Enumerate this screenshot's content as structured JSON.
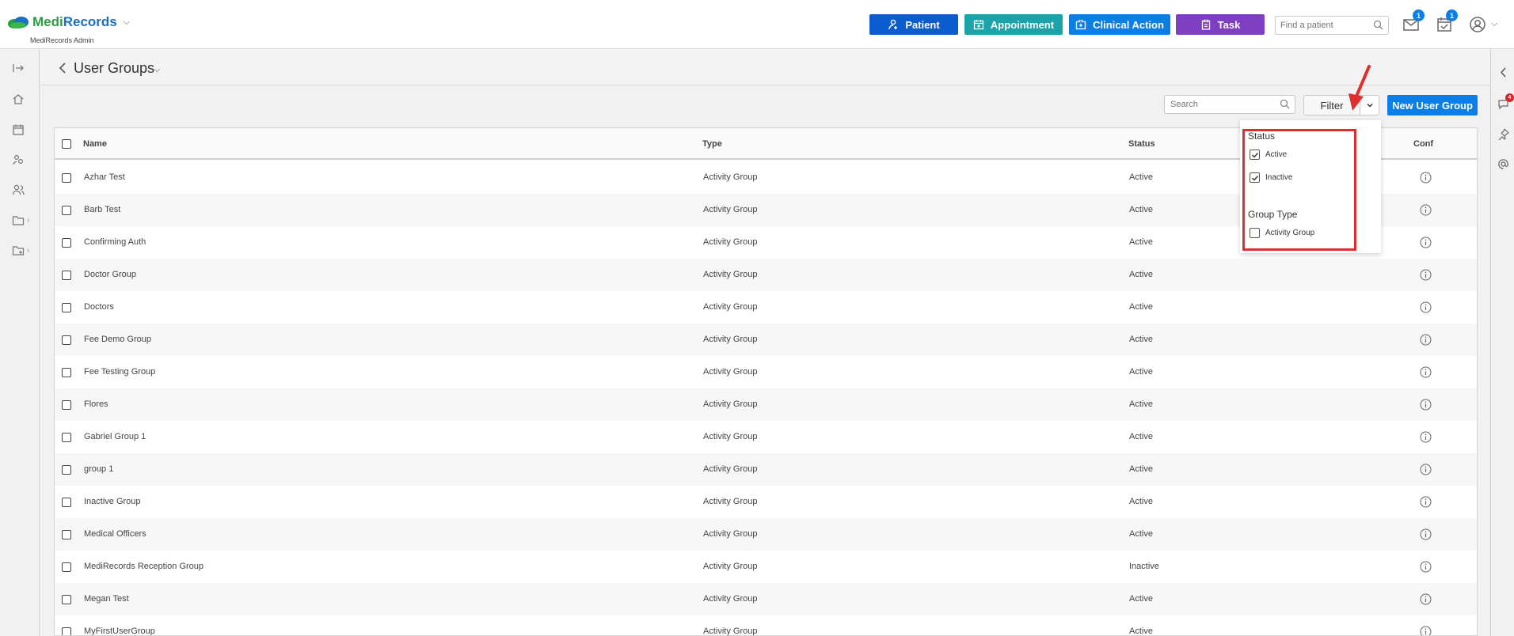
{
  "brand": {
    "name_part1": "Medi",
    "name_part2": "Records",
    "subtitle": "MediRecords Admin"
  },
  "topbar": {
    "patient_label": "Patient",
    "appointment_label": "Appointment",
    "clinical_action_label": "Clinical Action",
    "task_label": "Task",
    "find_patient_placeholder": "Find a patient",
    "messages_count": "1",
    "tasks_count": "1"
  },
  "colors": {
    "patient": "#0a5ccf",
    "appointment": "#1aa3a8",
    "clinical_action": "#0c7ee8",
    "task": "#7e3fc2",
    "primary": "#0c7ee8",
    "highlight": "#e02d2d"
  },
  "right_rail": {
    "notification_count": "4"
  },
  "page": {
    "title": "User Groups"
  },
  "toolbar": {
    "search_placeholder": "Search",
    "filter_label": "Filter",
    "new_label": "New User Group"
  },
  "filter": {
    "status_heading": "Status",
    "status_options": [
      {
        "label": "Active",
        "checked": true
      },
      {
        "label": "Inactive",
        "checked": true
      }
    ],
    "group_type_heading": "Group Type",
    "group_type_options": [
      {
        "label": "Activity Group",
        "checked": false
      }
    ]
  },
  "table": {
    "columns": {
      "name": "Name",
      "type": "Type",
      "status": "Status",
      "conf": "Conf"
    },
    "rows": [
      {
        "name": "Azhar Test",
        "type": "Activity Group",
        "status": "Active"
      },
      {
        "name": "Barb Test",
        "type": "Activity Group",
        "status": "Active"
      },
      {
        "name": "Confirming Auth",
        "type": "Activity Group",
        "status": "Active"
      },
      {
        "name": "Doctor Group",
        "type": "Activity Group",
        "status": "Active"
      },
      {
        "name": "Doctors",
        "type": "Activity Group",
        "status": "Active"
      },
      {
        "name": "Fee Demo Group",
        "type": "Activity Group",
        "status": "Active"
      },
      {
        "name": "Fee Testing Group",
        "type": "Activity Group",
        "status": "Active"
      },
      {
        "name": "Flores",
        "type": "Activity Group",
        "status": "Active"
      },
      {
        "name": "Gabriel Group 1",
        "type": "Activity Group",
        "status": "Active"
      },
      {
        "name": "group 1",
        "type": "Activity Group",
        "status": "Active"
      },
      {
        "name": "Inactive Group",
        "type": "Activity Group",
        "status": "Active"
      },
      {
        "name": "Medical Officers",
        "type": "Activity Group",
        "status": "Active"
      },
      {
        "name": "MediRecords Reception Group",
        "type": "Activity Group",
        "status": "Inactive"
      },
      {
        "name": "Megan Test",
        "type": "Activity Group",
        "status": "Active"
      },
      {
        "name": "MyFirstUserGroup",
        "type": "Activity Group",
        "status": "Active"
      }
    ]
  }
}
